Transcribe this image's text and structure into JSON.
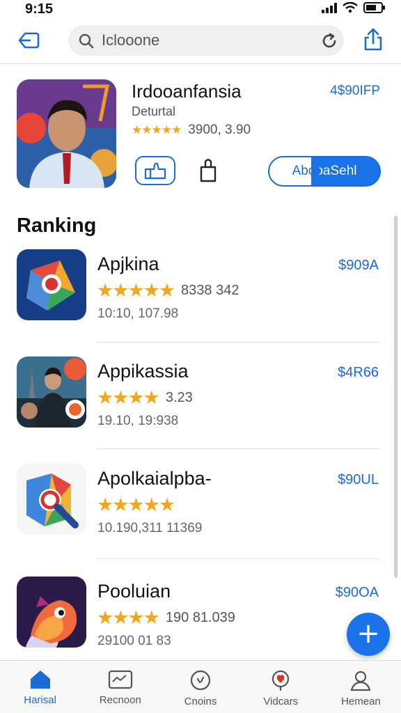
{
  "status_bar": {
    "time": "9:15"
  },
  "search": {
    "value": "Iclooone"
  },
  "featured": {
    "title": "Irdooanfansia",
    "subtitle": "Deturtal",
    "price": "4$90IFP",
    "rating_count": "3900, 3.90",
    "primary_button_label": "AbooaSehl",
    "stars": "★★★★★"
  },
  "ranking": {
    "title": "Ranking",
    "items": [
      {
        "name": "Apjkina",
        "price": "$909A",
        "stars": "★★★★★",
        "rating_count": "8338 342",
        "meta": "10:10, 107.98",
        "icon": "chrome-icon"
      },
      {
        "name": "Appikassia",
        "price": "$4R66",
        "stars": "★★★★",
        "rating_count": "3.23",
        "meta": "19.10, 19:938",
        "icon": "movie-poster-icon"
      },
      {
        "name": "Apolkaialpba-",
        "price": "$90UL",
        "stars": "★★★★★",
        "rating_count": "",
        "meta": "10.190,311 11369",
        "icon": "maps-search-icon"
      },
      {
        "name": "Pooluian",
        "price": "$90OA",
        "stars": "★★★★",
        "rating_count": "190 81.039",
        "meta": "29100 01 83",
        "icon": "fish-game-icon"
      }
    ]
  },
  "tabs": [
    {
      "label": "Harisal",
      "icon": "home-icon",
      "active": true
    },
    {
      "label": "Recnoon",
      "icon": "ticket-icon",
      "active": false
    },
    {
      "label": "Cnoins",
      "icon": "compass-icon",
      "active": false
    },
    {
      "label": "Vidcars",
      "icon": "heart-location-icon",
      "active": false
    },
    {
      "label": "Hemean",
      "icon": "profile-icon",
      "active": false
    }
  ],
  "colors": {
    "accent": "#1a73e8",
    "star": "#f0a71e",
    "text_secondary": "#555555"
  }
}
